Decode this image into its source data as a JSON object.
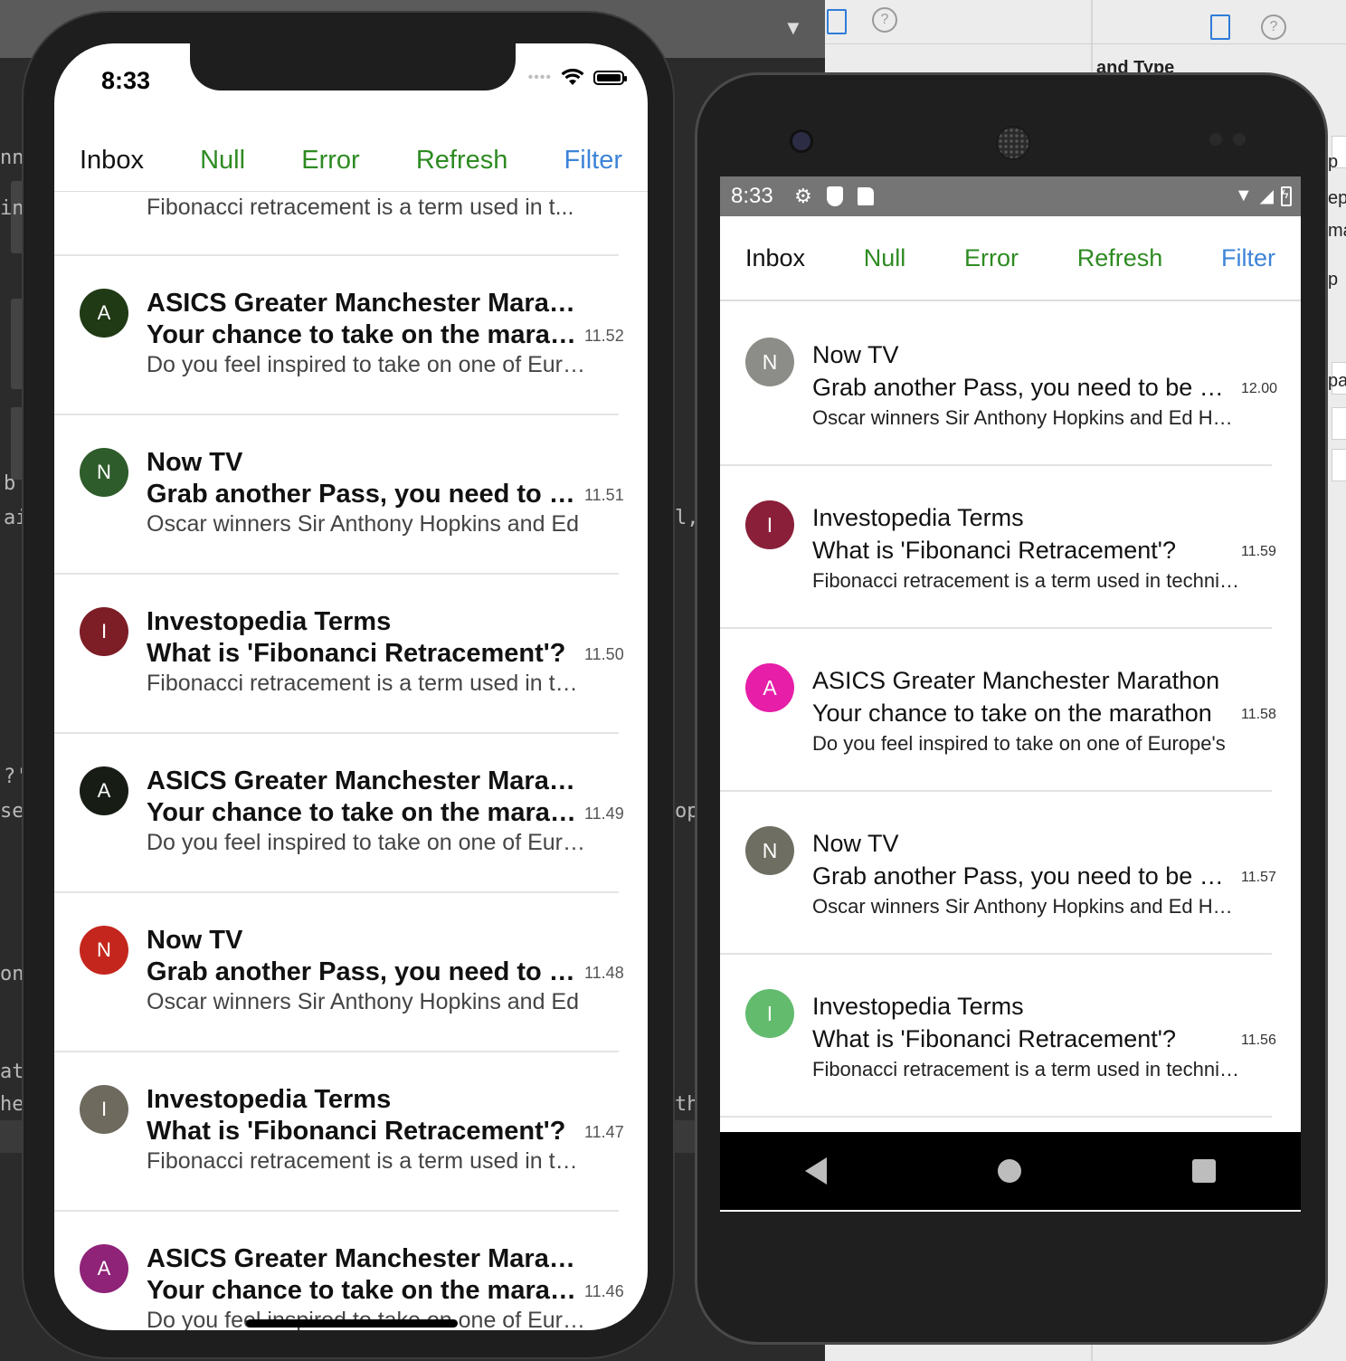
{
  "background": {
    "editor_fragments": [
      {
        "text": "nn"
      },
      {
        "text": "in"
      },
      {
        "text": "b"
      },
      {
        "text": "ai"
      },
      {
        "text": "?'"
      },
      {
        "text": "sed"
      },
      {
        "text": "on"
      },
      {
        "text": "atl"
      },
      {
        "text": "he"
      },
      {
        "text": "l,"
      },
      {
        "text": "op"
      },
      {
        "text": "th"
      }
    ],
    "inspector": {
      "section_title": "and Type",
      "right_fragments": [
        "p",
        "epr",
        "ma",
        "p",
        "pa"
      ]
    }
  },
  "ios": {
    "status_time": "8:33",
    "tabs": [
      {
        "label": "Inbox",
        "color": "#111111"
      },
      {
        "label": "Null",
        "color": "#2e8b22"
      },
      {
        "label": "Error",
        "color": "#2e8b22"
      },
      {
        "label": "Refresh",
        "color": "#2e8b22"
      },
      {
        "label": "Filter",
        "color": "#3d84d8"
      }
    ],
    "top_fragment": "Fibonacci retracement is a term used in t...",
    "messages": [
      {
        "initial": "A",
        "avatar_color": "#1f3a14",
        "sender": "ASICS Greater Manchester Marathon",
        "subject": "Your chance to take on the marathon",
        "preview": "Do you feel inspired to take on one of Europe's",
        "time": "11.52"
      },
      {
        "initial": "N",
        "avatar_color": "#2e5c2a",
        "sender": "Now TV",
        "subject": "Grab another Pass, you need to be watching",
        "preview": "Oscar winners Sir Anthony Hopkins and Ed",
        "time": "11.51"
      },
      {
        "initial": "I",
        "avatar_color": "#7d1d26",
        "sender": "Investopedia Terms",
        "subject": "What is 'Fibonanci Retracement'?",
        "preview": "Fibonacci retracement is a term used in technical",
        "time": "11.50"
      },
      {
        "initial": "A",
        "avatar_color": "#171c14",
        "sender": "ASICS Greater Manchester Marathon",
        "subject": "Your chance to take on the marathon",
        "preview": "Do you feel inspired to take on one of Europe's",
        "time": "11.49"
      },
      {
        "initial": "N",
        "avatar_color": "#c4261d",
        "sender": "Now TV",
        "subject": "Grab another Pass, you need to be watching",
        "preview": "Oscar winners Sir Anthony Hopkins and Ed",
        "time": "11.48"
      },
      {
        "initial": "I",
        "avatar_color": "#6f6a5e",
        "sender": "Investopedia Terms",
        "subject": "What is 'Fibonanci Retracement'?",
        "preview": "Fibonacci retracement is a term used in technical",
        "time": "11.47"
      },
      {
        "initial": "A",
        "avatar_color": "#8e2377",
        "sender": "ASICS Greater Manchester Marathon",
        "subject": "Your chance to take on the marathon",
        "preview": "Do you feel inspired to take on one of Europe's",
        "time": "11.46"
      }
    ]
  },
  "android": {
    "status_time": "8:33",
    "tabs": [
      {
        "label": "Inbox",
        "color": "#111111"
      },
      {
        "label": "Null",
        "color": "#2e8b22"
      },
      {
        "label": "Error",
        "color": "#2e8b22"
      },
      {
        "label": "Refresh",
        "color": "#2e8b22"
      },
      {
        "label": "Filter",
        "color": "#3d84d8"
      }
    ],
    "messages": [
      {
        "initial": "N",
        "avatar_color": "#8c8c88",
        "sender": "Now TV",
        "subject": "Grab another Pass, you need to be watching",
        "preview": "Oscar winners Sir Anthony Hopkins and Ed Harris",
        "time": "12.00"
      },
      {
        "initial": "I",
        "avatar_color": "#8a1f3a",
        "sender": "Investopedia Terms",
        "subject": "What is 'Fibonanci Retracement'?",
        "preview": "Fibonacci retracement is a term used in technical",
        "time": "11.59"
      },
      {
        "initial": "A",
        "avatar_color": "#e61ea8",
        "sender": "ASICS Greater Manchester Marathon",
        "subject": "Your chance to take on the marathon",
        "preview": "Do you feel inspired to take on one of Europe's",
        "time": "11.58"
      },
      {
        "initial": "N",
        "avatar_color": "#6e6e62",
        "sender": "Now TV",
        "subject": "Grab another Pass, you need to be watching",
        "preview": "Oscar winners Sir Anthony Hopkins and Ed Harris",
        "time": "11.57"
      },
      {
        "initial": "I",
        "avatar_color": "#63bb6e",
        "sender": "Investopedia Terms",
        "subject": "What is 'Fibonanci Retracement'?",
        "preview": "Fibonacci retracement is a term used in technical",
        "time": "11.56"
      }
    ],
    "nav": [
      "back-icon",
      "home-icon",
      "recents-icon"
    ]
  }
}
